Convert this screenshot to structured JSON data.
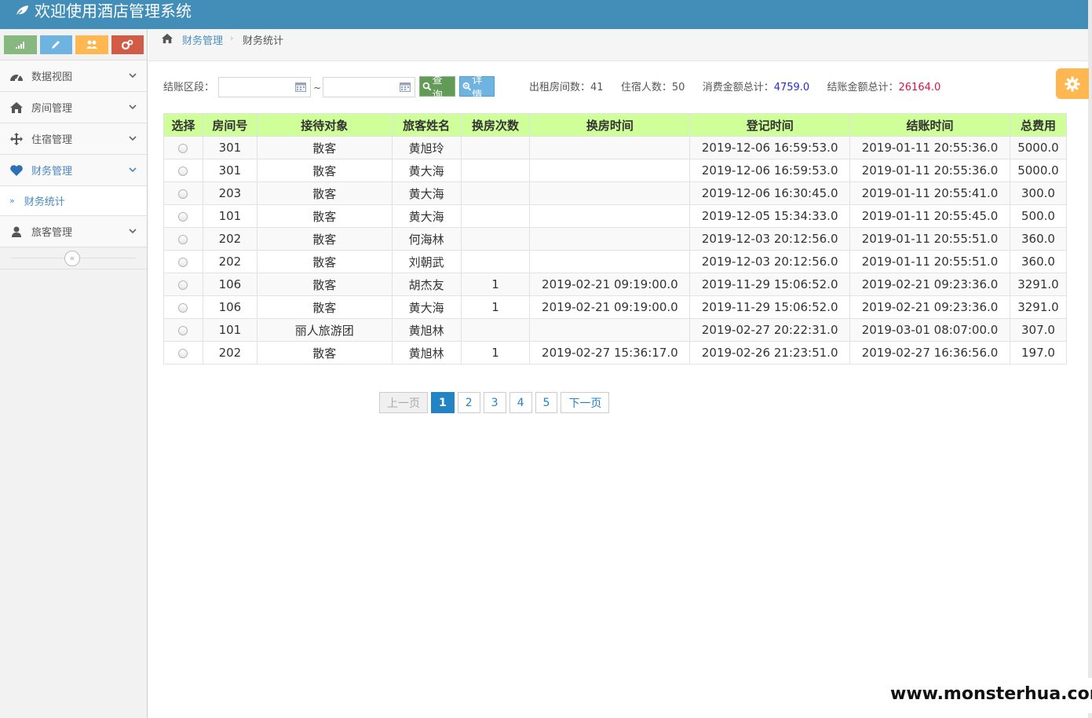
{
  "app": {
    "title": "欢迎使用酒店管理系统"
  },
  "colors": {
    "navbar": "#438eb9",
    "table_header": "#cfff99",
    "accent_blue": "#2283c5",
    "stat_blue": "#2b2bd1",
    "stat_red": "#dd1144"
  },
  "sidebar": {
    "shortcuts": [
      {
        "icon": "signal-icon",
        "color": "#87b87f"
      },
      {
        "icon": "pencil-icon",
        "color": "#6fb3e0"
      },
      {
        "icon": "users-icon",
        "color": "#ffb752"
      },
      {
        "icon": "cogs-icon",
        "color": "#d15b47"
      }
    ],
    "items": [
      {
        "label": "数据视图",
        "icon": "dashboard-icon"
      },
      {
        "label": "房间管理",
        "icon": "home-icon"
      },
      {
        "label": "住宿管理",
        "icon": "arrows-icon"
      },
      {
        "label": "财务管理",
        "icon": "heart-icon",
        "active": true
      },
      {
        "label": "旅客管理",
        "icon": "user-icon"
      }
    ],
    "sub_item": {
      "label": "财务统计"
    }
  },
  "breadcrumb": {
    "parent": "财务管理",
    "current": "财务统计"
  },
  "filter": {
    "label": "结账区段：",
    "start_value": "",
    "end_value": "",
    "separator": "~",
    "query_label": "查询",
    "detail_label": "详情"
  },
  "stats": {
    "rented_label": "出租房间数：",
    "rented_value": "41",
    "guests_label": "住宿人数：",
    "guests_value": "50",
    "consume_label": "消费金额总计：",
    "consume_value": "4759.0",
    "checkout_label": "结账金额总计：",
    "checkout_value": "26164.0"
  },
  "table": {
    "columns": [
      "选择",
      "房间号",
      "接待对象",
      "旅客姓名",
      "换房次数",
      "换房时间",
      "登记时间",
      "结账时间",
      "总费用"
    ],
    "rows": [
      [
        "301",
        "散客",
        "黄旭玲",
        "",
        "",
        "2019-12-06 16:59:53.0",
        "2019-01-11 20:55:36.0",
        "5000.0"
      ],
      [
        "301",
        "散客",
        "黄大海",
        "",
        "",
        "2019-12-06 16:59:53.0",
        "2019-01-11 20:55:36.0",
        "5000.0"
      ],
      [
        "203",
        "散客",
        "黄大海",
        "",
        "",
        "2019-12-06 16:30:45.0",
        "2019-01-11 20:55:41.0",
        "300.0"
      ],
      [
        "101",
        "散客",
        "黄大海",
        "",
        "",
        "2019-12-05 15:34:33.0",
        "2019-01-11 20:55:45.0",
        "500.0"
      ],
      [
        "202",
        "散客",
        "何海林",
        "",
        "",
        "2019-12-03 20:12:56.0",
        "2019-01-11 20:55:51.0",
        "360.0"
      ],
      [
        "202",
        "散客",
        "刘朝武",
        "",
        "",
        "2019-12-03 20:12:56.0",
        "2019-01-11 20:55:51.0",
        "360.0"
      ],
      [
        "106",
        "散客",
        "胡杰友",
        "1",
        "2019-02-21 09:19:00.0",
        "2019-11-29 15:06:52.0",
        "2019-02-21 09:23:36.0",
        "3291.0"
      ],
      [
        "106",
        "散客",
        "黄大海",
        "1",
        "2019-02-21 09:19:00.0",
        "2019-11-29 15:06:52.0",
        "2019-02-21 09:23:36.0",
        "3291.0"
      ],
      [
        "101",
        "丽人旅游团",
        "黄旭林",
        "",
        "",
        "2019-02-27 20:22:31.0",
        "2019-03-01 08:07:00.0",
        "307.0"
      ],
      [
        "202",
        "散客",
        "黄旭林",
        "1",
        "2019-02-27 15:36:17.0",
        "2019-02-26 21:23:51.0",
        "2019-02-27 16:36:56.0",
        "197.0"
      ]
    ]
  },
  "pagination": {
    "prev": "上一页",
    "pages": [
      "1",
      "2",
      "3",
      "4",
      "5"
    ],
    "current_page": "1",
    "next": "下一页"
  },
  "watermark": "www.monsterhua.com"
}
